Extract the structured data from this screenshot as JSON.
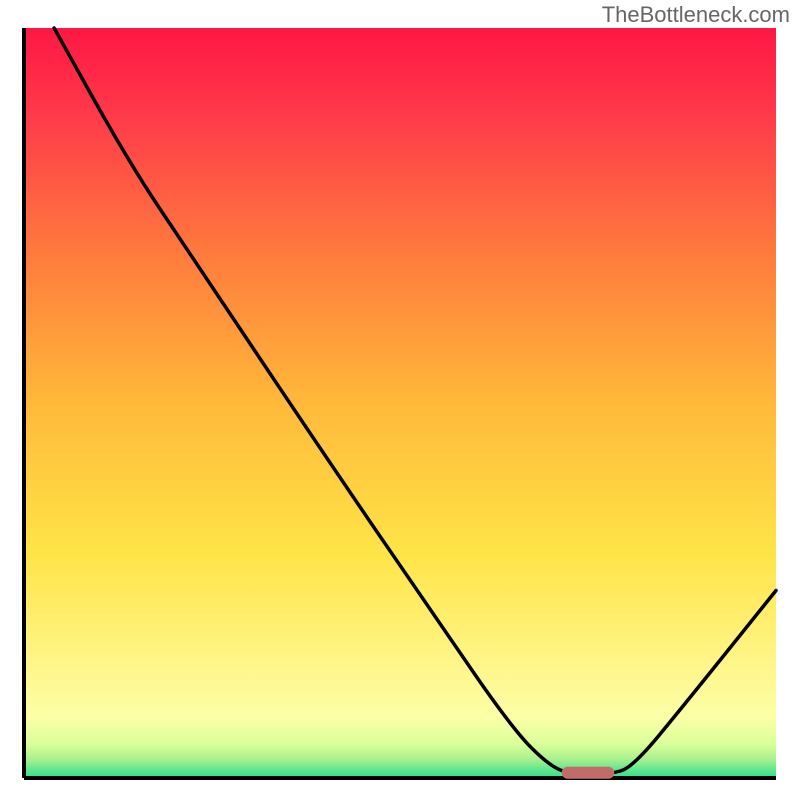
{
  "watermark": "TheBottleneck.com",
  "chart_data": {
    "type": "line",
    "title": "",
    "xlabel": "",
    "ylabel": "",
    "xlim": [
      0,
      100
    ],
    "ylim": [
      0,
      100
    ],
    "background_gradient": {
      "stops": [
        {
          "offset": 0.0,
          "color": "#ff1744"
        },
        {
          "offset": 0.12,
          "color": "#ff3b4a"
        },
        {
          "offset": 0.3,
          "color": "#ff7a3d"
        },
        {
          "offset": 0.5,
          "color": "#ffb93a"
        },
        {
          "offset": 0.7,
          "color": "#ffe447"
        },
        {
          "offset": 0.85,
          "color": "#fff68a"
        },
        {
          "offset": 0.92,
          "color": "#fbffa6"
        },
        {
          "offset": 0.955,
          "color": "#d9ff99"
        },
        {
          "offset": 0.975,
          "color": "#a8f08e"
        },
        {
          "offset": 0.99,
          "color": "#5ae68d"
        },
        {
          "offset": 1.0,
          "color": "#2ce08f"
        }
      ]
    },
    "series": [
      {
        "name": "bottleneck-curve",
        "color": "#000000",
        "points": [
          {
            "x": 4.0,
            "y": 100.0
          },
          {
            "x": 14.0,
            "y": 82.0
          },
          {
            "x": 22.0,
            "y": 70.0
          },
          {
            "x": 40.0,
            "y": 43.0
          },
          {
            "x": 55.0,
            "y": 21.0
          },
          {
            "x": 65.0,
            "y": 6.5
          },
          {
            "x": 70.0,
            "y": 1.5
          },
          {
            "x": 73.0,
            "y": 0.5
          },
          {
            "x": 78.0,
            "y": 0.5
          },
          {
            "x": 81.0,
            "y": 1.5
          },
          {
            "x": 88.0,
            "y": 10.0
          },
          {
            "x": 100.0,
            "y": 25.0
          }
        ]
      }
    ],
    "marker": {
      "name": "optimal-range",
      "color": "#c36b6b",
      "x_center": 75.0,
      "x_width": 7.0,
      "y": 0.7
    },
    "axes": {
      "left": {
        "visible": true,
        "color": "#000000"
      },
      "bottom": {
        "visible": true,
        "color": "#000000"
      },
      "right": {
        "visible": false
      },
      "top": {
        "visible": false
      }
    }
  }
}
